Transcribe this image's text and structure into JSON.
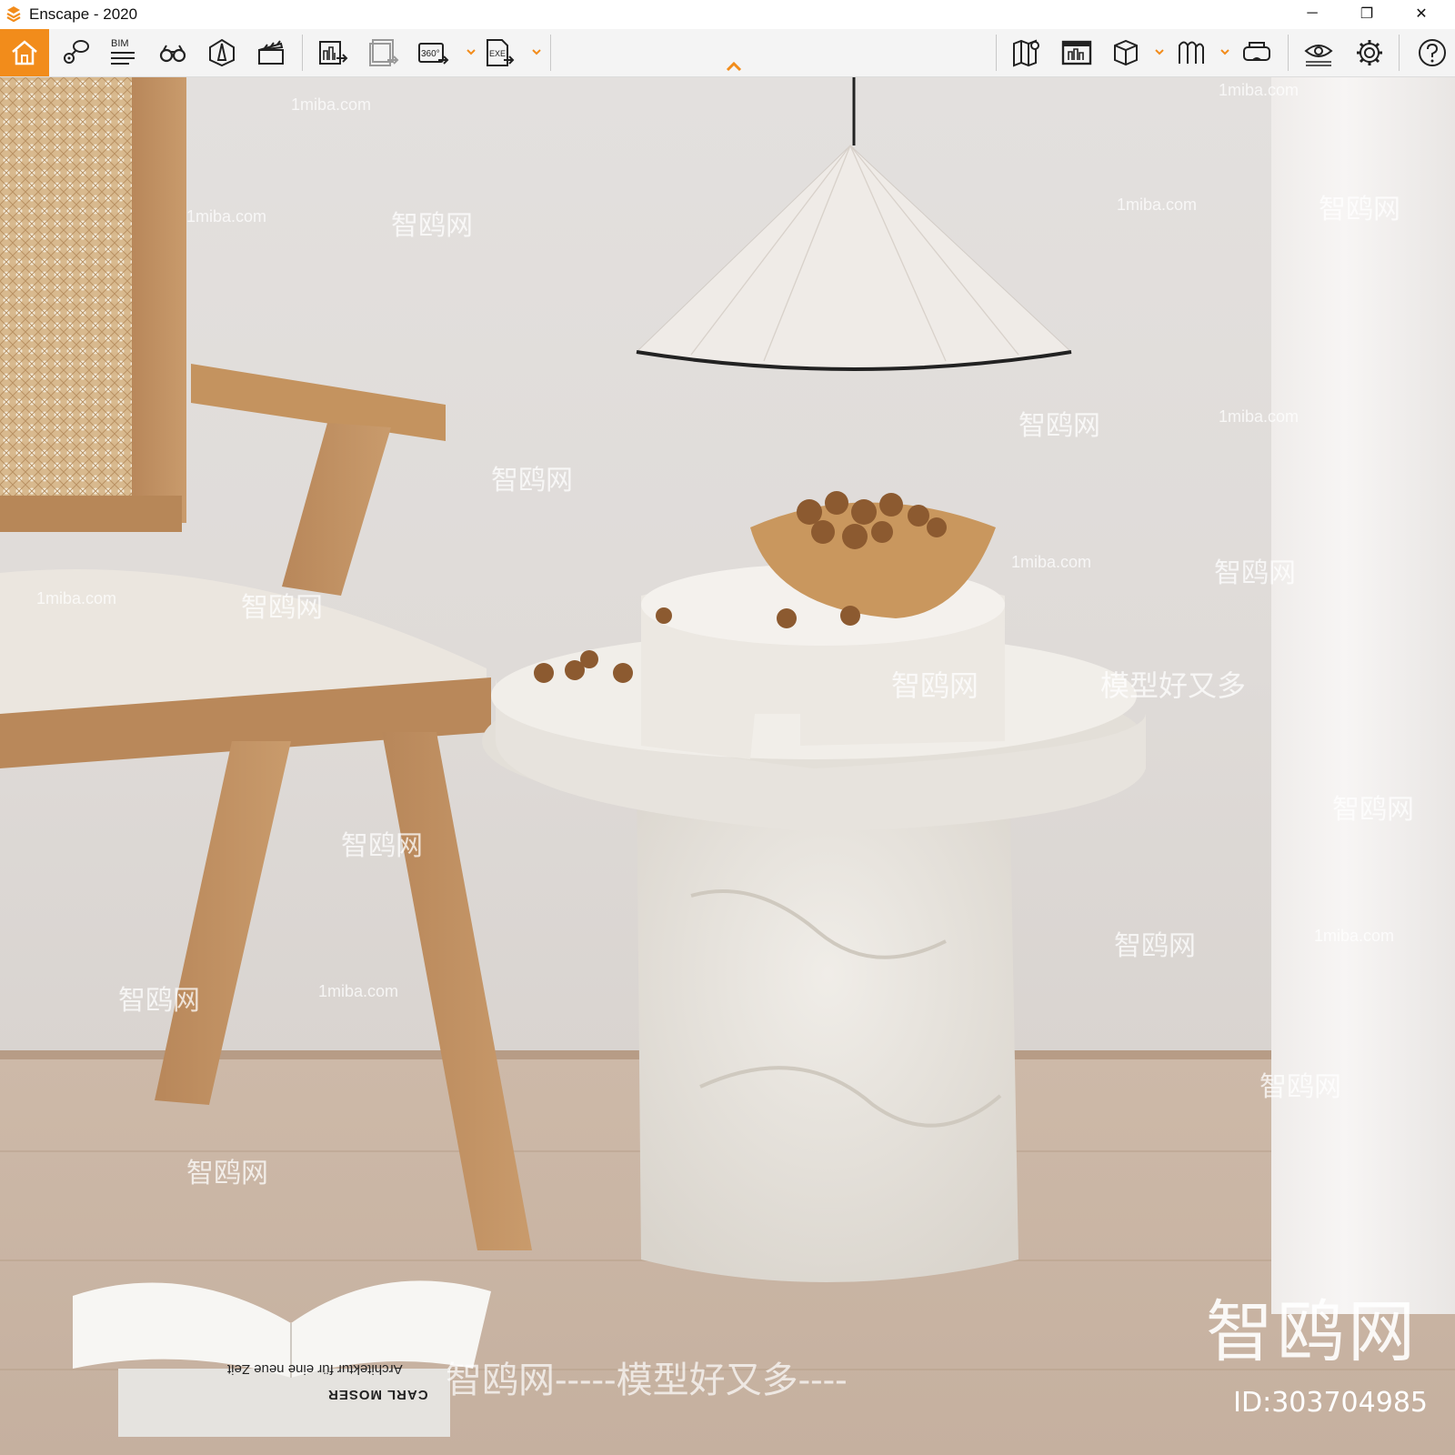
{
  "window": {
    "title": "Enscape - 2020",
    "minimize": "─",
    "restore": "❐",
    "close": "✕"
  },
  "toolbar": {
    "bim_label": "BIM",
    "panorama_label": "360°",
    "exe_label": "EXE",
    "accent_color": "#f28c1b",
    "left_items": [
      "home-icon",
      "pin-icon",
      "bim-icon",
      "binoculars-icon",
      "lighthouse-icon",
      "clapper-icon",
      "render-icon",
      "batch-render-icon",
      "panorama-icon",
      "exe-export-icon"
    ],
    "right_items": [
      "map-icon",
      "asset-library-icon",
      "cube-icon",
      "materials-icon",
      "vr-icon",
      "visual-settings-icon",
      "settings-icon",
      "help-icon"
    ]
  },
  "scene": {
    "watermarks": [
      "1miba.com",
      "智鸥网",
      "模型好又多"
    ],
    "wm_big": "智鸥网",
    "wm_id": "ID:303704985",
    "wm_bottom": "智鸥网-----模型好又多----",
    "book_line1": "Architektur für eine neue Zeit",
    "book_line2": "CARL MOSER"
  }
}
